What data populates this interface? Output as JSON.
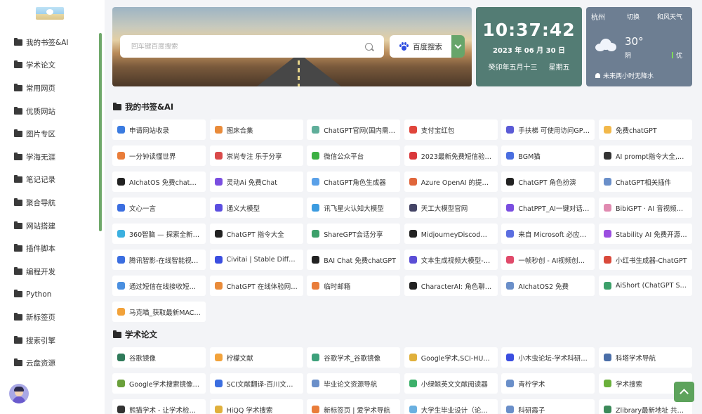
{
  "sidebar": {
    "items": [
      {
        "label": "我的书签&AI"
      },
      {
        "label": "学术论文"
      },
      {
        "label": "常用网页"
      },
      {
        "label": "优质网站"
      },
      {
        "label": "图片专区"
      },
      {
        "label": "学海无涯"
      },
      {
        "label": "笔记记录"
      },
      {
        "label": "聚合导航"
      },
      {
        "label": "网站搭建"
      },
      {
        "label": "插件脚本"
      },
      {
        "label": "编程开发"
      },
      {
        "label": "Python"
      },
      {
        "label": "新标签页"
      },
      {
        "label": "搜索引擎"
      },
      {
        "label": "云盘资源"
      }
    ],
    "active_color": "#6fa86a"
  },
  "search": {
    "placeholder": "回车键百度搜索",
    "engine_label": "百度搜索",
    "engine_icon": "baidu-paw-icon",
    "toggle_color": "#67a56a"
  },
  "clock": {
    "time": "10:37:42",
    "date": "2023 年 06 月 30 日",
    "lunar": "癸卯年五月十三",
    "weekday": "星期五",
    "bg_color": "#537c74"
  },
  "weather": {
    "city": "杭州",
    "switch_label": "切换",
    "wind": "和风天气",
    "temp": "30°",
    "desc": "阴",
    "aqi": "优",
    "note": "未来两小时无降水",
    "icon": "cloud-icon"
  },
  "sections": [
    {
      "title": "我的书签&AI",
      "cards": [
        {
          "label": "申请网站收录",
          "icon_color": "#3b7be0"
        },
        {
          "label": "图床合集",
          "icon_color": "#e98b3a"
        },
        {
          "label": "ChatGPT官网(国内需…",
          "icon_color": "#5fae9a"
        },
        {
          "label": "支付宝红包",
          "icon_color": "#e0453b"
        },
        {
          "label": "手扶梯 可使用访问GP…",
          "icon_color": "#5b5bd6"
        },
        {
          "label": "免费chatGPT",
          "icon_color": "#f2b84a"
        },
        {
          "label": "一分钟读懂世界",
          "icon_color": "#e97d3a"
        },
        {
          "label": "崇尚专注 乐于分享",
          "icon_color": "#d94a4a"
        },
        {
          "label": "微信公众平台",
          "icon_color": "#3cb043"
        },
        {
          "label": "2023最新免费短信验…",
          "icon_color": "#d9383b"
        },
        {
          "label": "BGM猫",
          "icon_color": "#4a6ee0"
        },
        {
          "label": "AI prompt指令大全,…",
          "icon_color": "#333333"
        },
        {
          "label": "AIchatOS 免费chatGPT",
          "icon_color": "#222222"
        },
        {
          "label": "灵动Ai 免费Chat",
          "icon_color": "#7a4ee0"
        },
        {
          "label": "ChatGPT角色生成器",
          "icon_color": "#5aa0e8"
        },
        {
          "label": "Azure OpenAI 的提示…",
          "icon_color": "#e0663b"
        },
        {
          "label": "ChatGPT 角色扮演",
          "icon_color": "#222222"
        },
        {
          "label": "ChatGPT相关插件",
          "icon_color": "#6a8fc9"
        },
        {
          "label": "文心一言",
          "icon_color": "#3b6ee0"
        },
        {
          "label": "通义大模型",
          "icon_color": "#5b4ee0"
        },
        {
          "label": "讯飞星火认知大模型",
          "icon_color": "#3b9be0"
        },
        {
          "label": "天工大模型官网",
          "icon_color": "#444466"
        },
        {
          "label": "ChatPPT_AI一键对话…",
          "icon_color": "#7a4ee0"
        },
        {
          "label": "BibiGPT · AI 音视频…",
          "icon_color": "#e08ab0"
        },
        {
          "label": "360智脑 — 探索全新…",
          "icon_color": "#3bb0e0"
        },
        {
          "label": "ChatGPT 指令大全",
          "icon_color": "#222222"
        },
        {
          "label": "ShareGPT会话分享",
          "icon_color": "#3ca06a"
        },
        {
          "label": "MidjourneyDiscod旗…",
          "icon_color": "#222222"
        },
        {
          "label": "来自 Microsoft 必应…",
          "icon_color": "#5b6ee0"
        },
        {
          "label": "Stability AI 免费开源…",
          "icon_color": "#9b4ee0"
        },
        {
          "label": "腾讯智影-在线智能视…",
          "icon_color": "#3b6ee0"
        },
        {
          "label": "Civitai | Stable Diffu…",
          "icon_color": "#3b4ee0"
        },
        {
          "label": "BAI Chat 免费chatGPT",
          "icon_color": "#222222"
        },
        {
          "label": "文本生成视频大模型-…",
          "icon_color": "#5b4ed6"
        },
        {
          "label": "一帧秒创 - AI视频创作…",
          "icon_color": "#e04a6a"
        },
        {
          "label": "小红书生成器-ChatGPT",
          "icon_color": "#d94a3b"
        },
        {
          "label": "通过短信在线接收短…",
          "icon_color": "#4a8fe0"
        },
        {
          "label": "ChatGPT 在线体验网…",
          "icon_color": "#e98b3a"
        },
        {
          "label": "临时邮箱",
          "icon_color": "#e97d3a"
        },
        {
          "label": "CharacterAI: 角色聊…",
          "icon_color": "#222222"
        },
        {
          "label": "AIchatOS2 免费",
          "icon_color": "#6a8fc9"
        },
        {
          "label": "AiShort (ChatGPT S…",
          "icon_color": "#3ca06a"
        },
        {
          "label": "马克喵_获取最新MAC…",
          "icon_color": "#f2a23a"
        }
      ]
    },
    {
      "title": "学术论文",
      "cards": [
        {
          "label": "谷歌镜像",
          "icon_color": "#2f7a5a"
        },
        {
          "label": "柠檬文献",
          "icon_color": "#f2a23a"
        },
        {
          "label": "谷歌学术_谷歌镜像",
          "icon_color": "#3ca07a"
        },
        {
          "label": "Google学术,SCI-HUB…",
          "icon_color": "#e0b03b"
        },
        {
          "label": "小木虫论坛-学术科研…",
          "icon_color": "#3b4ee0"
        },
        {
          "label": "科塔学术导航",
          "icon_color": "#4a6ea8"
        },
        {
          "label": "Google学术搜索镜像…",
          "icon_color": "#6aa03b"
        },
        {
          "label": "SCI文献翻译-百川文…",
          "icon_color": "#3b6ee0"
        },
        {
          "label": "毕业论文资源导航",
          "icon_color": "#6a8fc9"
        },
        {
          "label": "小绿鲸英文文献阅读器",
          "icon_color": "#3cb06a"
        },
        {
          "label": "青柠学术",
          "icon_color": "#6a8fc9"
        },
        {
          "label": "学术搜索",
          "icon_color": "#6ab03b"
        },
        {
          "label": "熊猫学术 - 让学术检索…",
          "icon_color": "#333333"
        },
        {
          "label": "HiQQ 学术搜索",
          "icon_color": "#e0b03b"
        },
        {
          "label": "新标签页 | 爱学术导航",
          "icon_color": "#e97d3a"
        },
        {
          "label": "大学生毕业设计（论…",
          "icon_color": "#6ab0e0"
        },
        {
          "label": "科研霞子",
          "icon_color": "#6a8fc9"
        },
        {
          "label": "Zlibrary最新地址 共…",
          "icon_color": "#3c8a5a"
        }
      ]
    }
  ]
}
